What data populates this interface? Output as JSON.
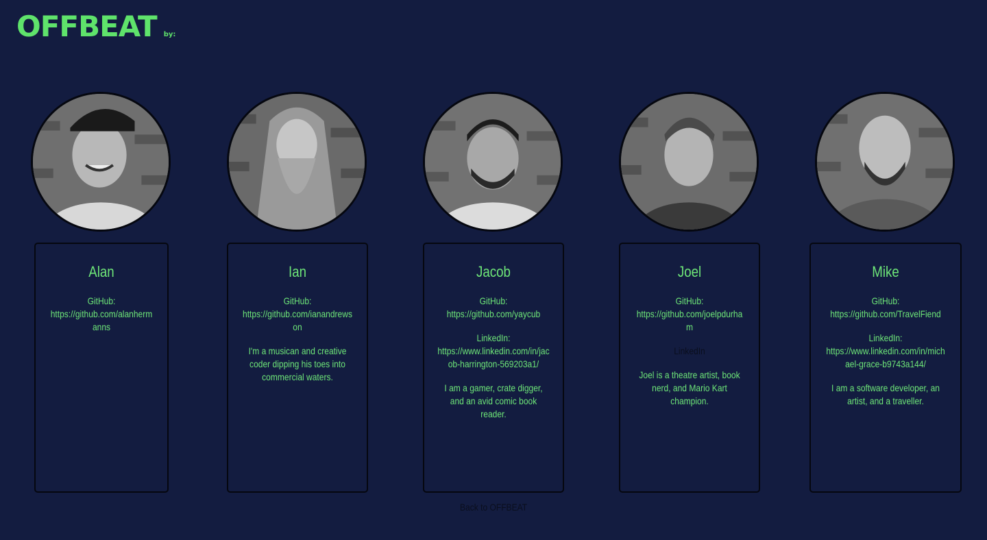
{
  "logo": {
    "word": "OFFBEAT",
    "by": "by:"
  },
  "members": [
    {
      "name": "Alan",
      "github_label": "GitHub:",
      "github_url": "https://github.com/alanhermanns",
      "linkedin_label": "",
      "linkedin_url": "",
      "bio": ""
    },
    {
      "name": "Ian",
      "github_label": "GitHub:",
      "github_url": "https://github.com/ianandrewson",
      "linkedin_label": "",
      "linkedin_url": "",
      "bio": "I'm a musican and creative coder dipping his toes into commercial waters."
    },
    {
      "name": "Jacob",
      "github_label": "GitHub:",
      "github_url": "https://github.com/yaycub",
      "linkedin_label": "LinkedIn:",
      "linkedin_url": "https://www.linkedin.com/in/jacob-harrington-569203a1/",
      "bio": "I am a gamer, crate digger, and an avid comic book reader."
    },
    {
      "name": "Joel",
      "github_label": "GitHub:",
      "github_url": "https://github.com/joelpdurham",
      "linkedin_label": "LinkedIn",
      "linkedin_url": "",
      "bio": "Joel is a theatre artist, book nerd, and Mario Kart champion."
    },
    {
      "name": "Mike",
      "github_label": "GitHub:",
      "github_url": "https://github.com/TravelFiend",
      "linkedin_label": "LinkedIn:",
      "linkedin_url": "https://www.linkedin.com/in/michael-grace-b9743a144/",
      "bio": "I am a software developer, an artist, and a traveller."
    }
  ],
  "back_link": "Back to OFFBEAT",
  "colors": {
    "background": "#131c40",
    "accent": "#5fe36b",
    "text": "#6ee678",
    "border": "#05070f"
  }
}
